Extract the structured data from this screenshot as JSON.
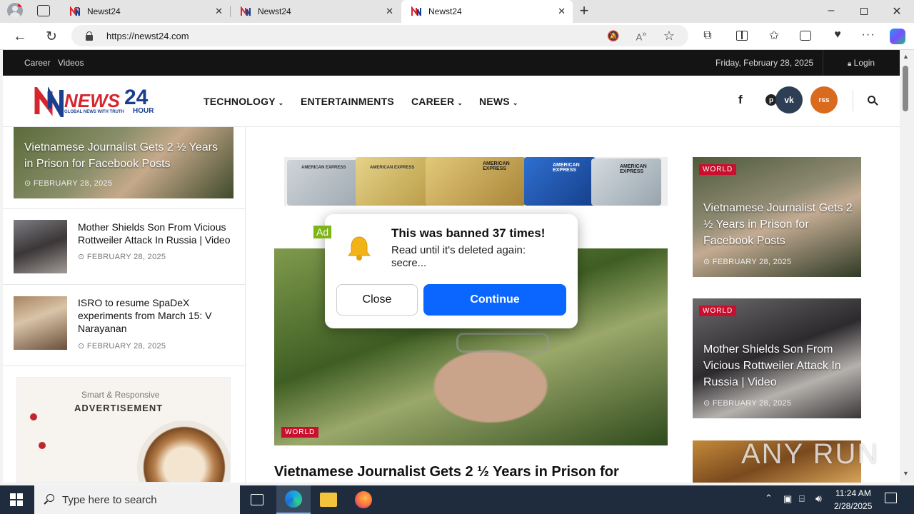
{
  "browser": {
    "tabs": [
      {
        "label": "Newst24"
      },
      {
        "label": "Newst24"
      },
      {
        "label": "Newst24"
      }
    ],
    "url": "https://newst24.com"
  },
  "site": {
    "topbar": {
      "links": [
        "Career",
        "Videos"
      ],
      "date": "Friday, February 28, 2025",
      "login": "Login"
    },
    "logo": {
      "word": "NEWS",
      "number": "24",
      "hour": "HOUR",
      "tagline": "GLOBAL NEWS WITH TRUTH"
    },
    "nav": [
      "TECHNOLOGY",
      "ENTERTAINMENTS",
      "CAREER",
      "NEWS"
    ],
    "social": {
      "facebook": "f",
      "pinterest": "p",
      "vk": "vk",
      "rss": "rss"
    },
    "sidebar": {
      "featured": {
        "title": "Vietnamese Journalist Gets 2 ½ Years in Prison for Facebook Posts",
        "date": "FEBRUARY 28, 2025"
      },
      "items": [
        {
          "title": "Mother Shields Son From Vicious Rottweiler Attack In Russia | Video",
          "date": "FEBRUARY 28, 2025"
        },
        {
          "title": "ISRO to resume SpaDeX experiments from March 15: V Narayanan",
          "date": "FEBRUARY 28, 2025"
        }
      ],
      "ad": {
        "line1": "Smart & Responsive",
        "line2": "ADVERTISEMENT"
      }
    },
    "banner": {
      "cards": [
        "AMERICAN EXPRESS",
        "AMERICAN EXPRESS",
        "AMERICAN EXPRESS",
        "AMERICAN EXPRESS",
        "AMERICAN EXPRESS"
      ]
    },
    "main": {
      "tag": "WORLD",
      "headline": "Vietnamese Journalist Gets 2 ½ Years in Prison for"
    },
    "right": [
      {
        "tag": "WORLD",
        "title": "Vietnamese Journalist Gets 2 ½ Years in Prison for Facebook Posts",
        "date": "FEBRUARY 28, 2025"
      },
      {
        "tag": "WORLD",
        "title": "Mother Shields Son From Vicious Rottweiler Attack In Russia | Video",
        "date": "FEBRUARY 28, 2025"
      }
    ]
  },
  "modal": {
    "ad_label": "Ad",
    "title": "This was banned 37 times!",
    "body": "Read until it's deleted again: secre...",
    "close": "Close",
    "continue": "Continue"
  },
  "watermark": "ANY RUN",
  "taskbar": {
    "search_placeholder": "Type here to search",
    "time": "11:24 AM",
    "date": "2/28/2025"
  },
  "colors": {
    "accent_blue": "#0a66ff",
    "tag_red": "#c8102e",
    "ad_green": "#7cb518",
    "logo_red": "#d6262d",
    "logo_blue": "#1b3f8f"
  }
}
